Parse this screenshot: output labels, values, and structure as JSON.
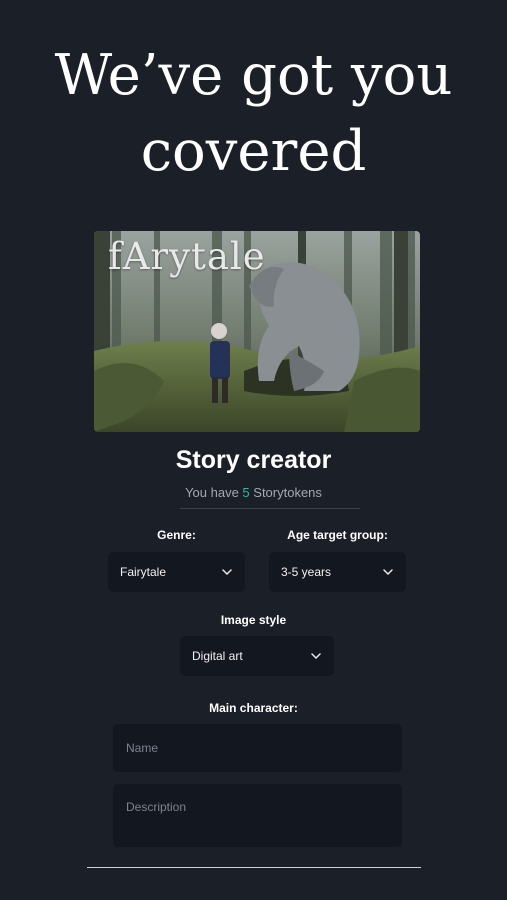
{
  "headline": {
    "line1": "We’ve got you",
    "line2": "covered"
  },
  "hero": {
    "logo_text": "fArytale",
    "image": "forest-troll-illustration"
  },
  "creator": {
    "title": "Story creator",
    "tokens_prefix": "You have ",
    "tokens_count": "5",
    "tokens_suffix": " Storytokens"
  },
  "form": {
    "genre_label": "Genre:",
    "genre_value": "Fairytale",
    "age_label": "Age target group:",
    "age_value": "3-5 years",
    "style_label": "Image style",
    "style_value": "Digital art",
    "character_label": "Main character:",
    "name_placeholder": "Name",
    "description_placeholder": "Description"
  },
  "colors": {
    "background": "#1b1f27",
    "field": "#131720",
    "accent": "#35b39b"
  },
  "icons": {
    "dropdown": "chevron-down-icon"
  }
}
